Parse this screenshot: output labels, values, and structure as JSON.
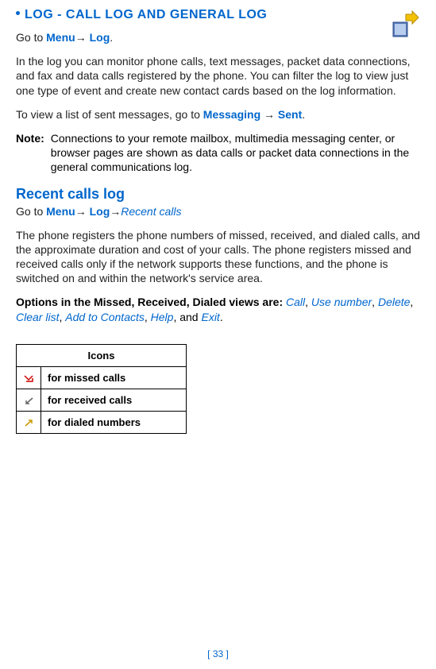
{
  "header": {
    "title": "LOG - CALL LOG AND GENERAL LOG"
  },
  "intro": {
    "goto_prefix": "Go to ",
    "menu": "Menu",
    "arrow": "→",
    "log": "Log",
    "period": "."
  },
  "desc": "In the log you can monitor phone calls, text messages, packet data connections, and fax and data calls registered by the phone. You can filter the log to view just one type of event and create new contact cards based on the log information.",
  "sent_line": {
    "prefix": "To view a list of sent messages, go to ",
    "messaging": "Messaging",
    "arrow": " → ",
    "sent": "Sent",
    "period": "."
  },
  "note": {
    "label": "Note:",
    "text": "Connections to your remote mailbox, multimedia messaging center, or browser pages are shown as data calls or packet data connections in the general communications log."
  },
  "recent": {
    "heading": "Recent calls log",
    "goto_prefix": "Go to ",
    "menu": "Menu",
    "arrow": "→",
    "log": "Log",
    "recent_calls": "Recent calls"
  },
  "recent_desc": "The phone registers the phone numbers of missed, received, and dialed calls, and the approximate duration and cost of your calls.  The phone registers missed and received calls only if the network supports these functions, and the phone is switched on and within the network's service area.",
  "options": {
    "prefix": "Options in the Missed, Received, Dialed views are:",
    "items": [
      "Call",
      "Use number",
      "Delete",
      "Clear list",
      "Add to Contacts",
      "Help"
    ],
    "and": ", and ",
    "last": "Exit",
    "period": "."
  },
  "table": {
    "header": "Icons",
    "rows": [
      {
        "icon": "missed-call-icon",
        "label": "for missed calls"
      },
      {
        "icon": "received-call-icon",
        "label": "for received calls"
      },
      {
        "icon": "dialed-number-icon",
        "label": "for dialed numbers"
      }
    ]
  },
  "footer": {
    "page_num": "[ 33 ]"
  }
}
